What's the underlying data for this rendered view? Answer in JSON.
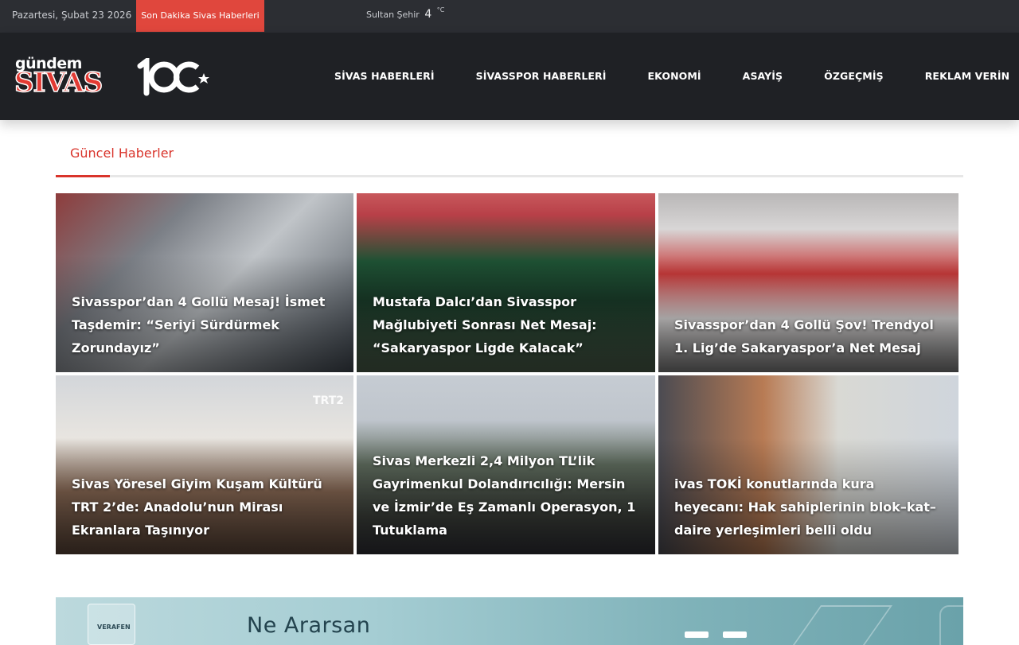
{
  "topbar": {
    "date": "Pazartesi, Şubat 23 2026",
    "breaking_label": "Son Dakika Sivas Haberleri",
    "weather": {
      "location": "Sultan Şehir",
      "temperature": "4",
      "unit": "°C"
    }
  },
  "header": {
    "logo": {
      "top": "gündem",
      "main": "SIVAS"
    },
    "badge": "100",
    "nav": [
      {
        "label": "SİVAS HABERLERİ"
      },
      {
        "label": "SİVASSPOR HABERLERİ"
      },
      {
        "label": "EKONOMİ"
      },
      {
        "label": "ASAYİŞ"
      },
      {
        "label": "ÖZGEÇMİŞ"
      },
      {
        "label": "REKLAM VERİN"
      }
    ]
  },
  "section": {
    "title": "Güncel Haberler"
  },
  "news": [
    {
      "headline": "Sivasspor’dan 4 Gollü Mesaj! İsmet Taşdemir: “Seriyi Sürdürmek Zorundayız”"
    },
    {
      "headline": "Mustafa Dalcı’dan Sivasspor Mağlubiyeti Sonrası Net Mesaj: “Sakaryaspor Ligde Kalacak”"
    },
    {
      "headline": "Sivasspor’dan 4 Gollü Şov! Trendyol 1. Lig’de Sakaryaspor’a Net Mesaj"
    },
    {
      "headline": "Sivas Yöresel Giyim Kuşam Kültürü TRT 2’de: Anadolu’nun Mirası Ekranlara Taşınıyor",
      "watermark": "TRT2"
    },
    {
      "headline": "Sivas Merkezli 2,4 Milyon TL’lik Gayrimenkul Dolandırıcılığı: Mersin ve İzmir’de Eş Zamanlı Operasyon, 1 Tutuklama"
    },
    {
      "headline": "ivas TOKİ konutlarında kura heyecanı: Hak sahiplerinin blok–kat–daire yerleşimleri belli oldu"
    }
  ],
  "banner": {
    "brand": "VERAFEN",
    "headline": "Ne Ararsan"
  }
}
